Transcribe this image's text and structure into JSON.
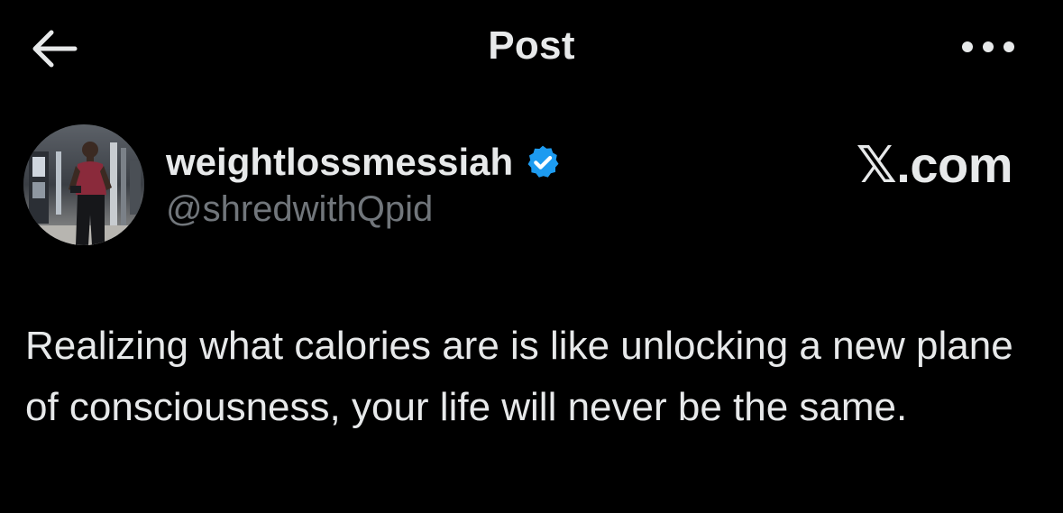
{
  "header": {
    "title": "Post",
    "back_icon": "arrow-left-icon",
    "more_icon": "more-horizontal-icon"
  },
  "author": {
    "display_name": "weightlossmessiah",
    "handle": "@shredwithQpid",
    "verified": true,
    "verified_color": "#1d9bf0"
  },
  "watermark": "𝕏.com",
  "post": {
    "text": "Realizing what calories are is like unlocking a new plane of consciousness, your life will never be the same."
  },
  "colors": {
    "background": "#000000",
    "text_primary": "#e7e9ea",
    "text_secondary": "#71767b",
    "accent": "#1d9bf0"
  }
}
